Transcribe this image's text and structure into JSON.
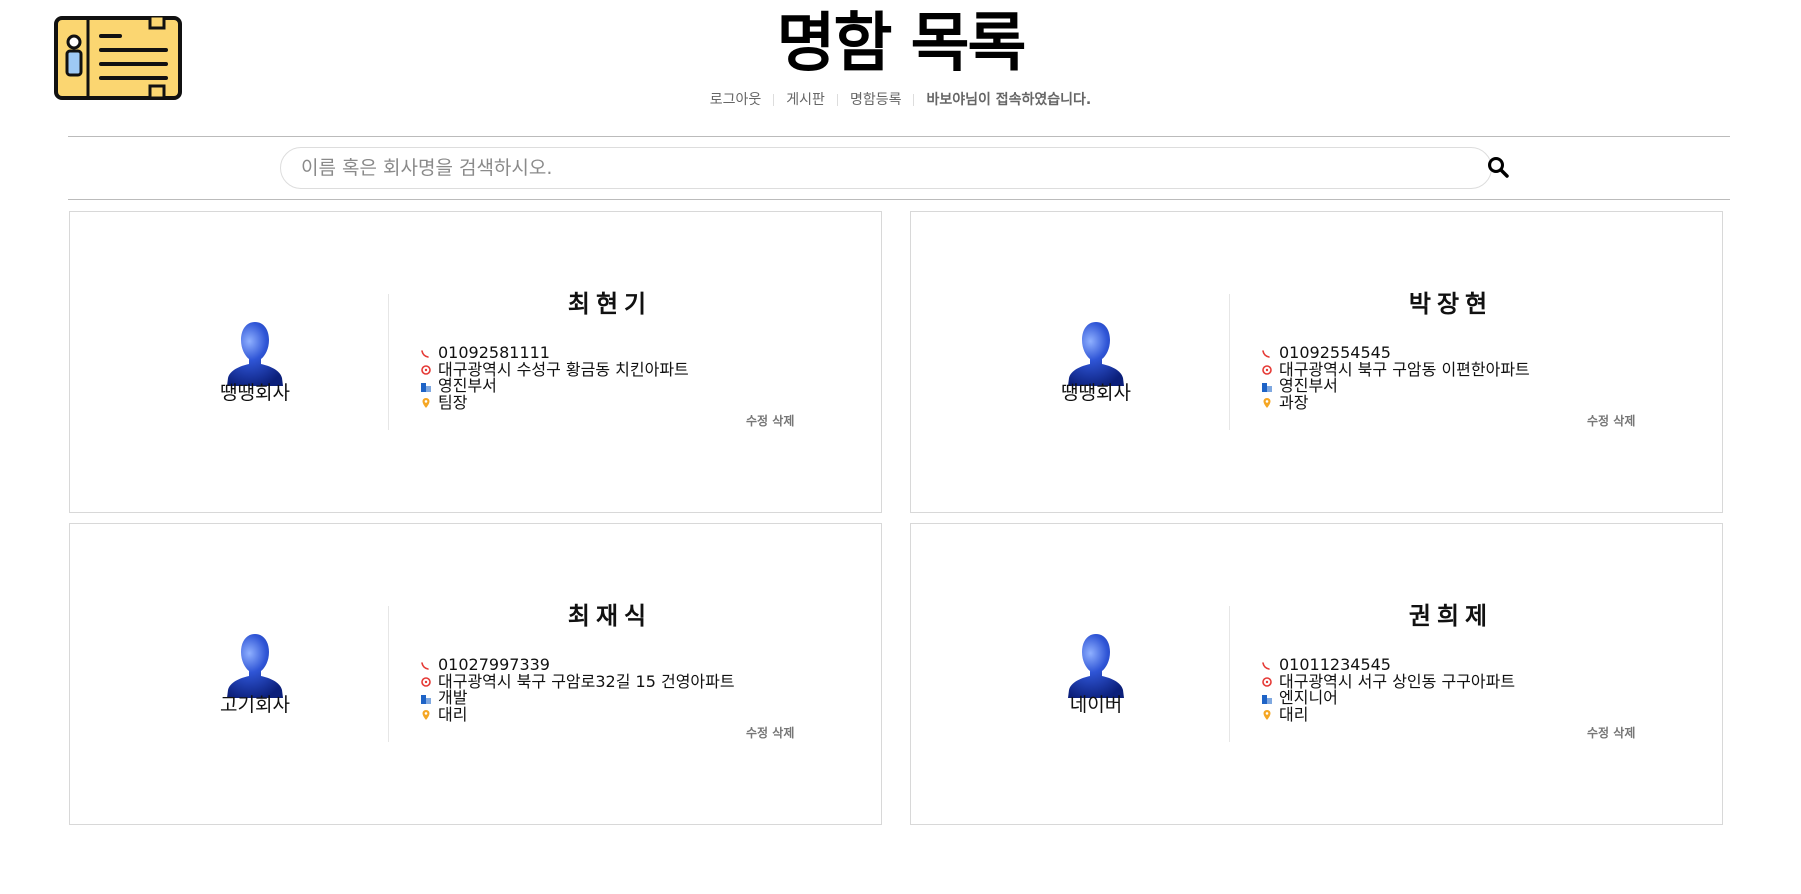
{
  "header": {
    "title": "명함 목록",
    "nav": {
      "logout": "로그아웃",
      "board": "게시판",
      "register": "명함등록",
      "welcome": "바보야님이 접속하였습니다."
    }
  },
  "search": {
    "placeholder": "이름 혹은 회사명을 검색하시오."
  },
  "actions": {
    "edit": "수정",
    "delete": "삭제"
  },
  "cards": [
    {
      "company": "땡땡회사",
      "name": "최현기",
      "phone": "01092581111",
      "address": "대구광역시 수성구 황금동 치킨아파트",
      "department": "영진부서",
      "position": "팀장"
    },
    {
      "company": "땡땡회사",
      "name": "박장현",
      "phone": "01092554545",
      "address": "대구광역시 북구 구암동 이편한아파트",
      "department": "영진부서",
      "position": "과장"
    },
    {
      "company": "고기회사",
      "name": "최재식",
      "phone": "01027997339",
      "address": "대구광역시 북구 구암로32길 15 건영아파트",
      "department": "개발",
      "position": "대리"
    },
    {
      "company": "네이버",
      "name": "권희제",
      "phone": "01011234545",
      "address": "대구광역시 서구 상인동 구구아파트",
      "department": "엔지니어",
      "position": "대리"
    }
  ],
  "icons": {
    "logo": "business-card-icon",
    "search": "search-icon",
    "avatar": "user-silhouette-icon",
    "phone": "phone-icon",
    "address": "location-ring-icon",
    "department": "building-icon",
    "position": "map-pin-icon"
  },
  "colors": {
    "logo_fill": "#fbd671",
    "avatar_blue": "#1b3fb8",
    "phone_icon": "#e53935",
    "address_icon": "#e53935",
    "department_icon": "#1e63c6",
    "position_icon": "#f5a623"
  }
}
